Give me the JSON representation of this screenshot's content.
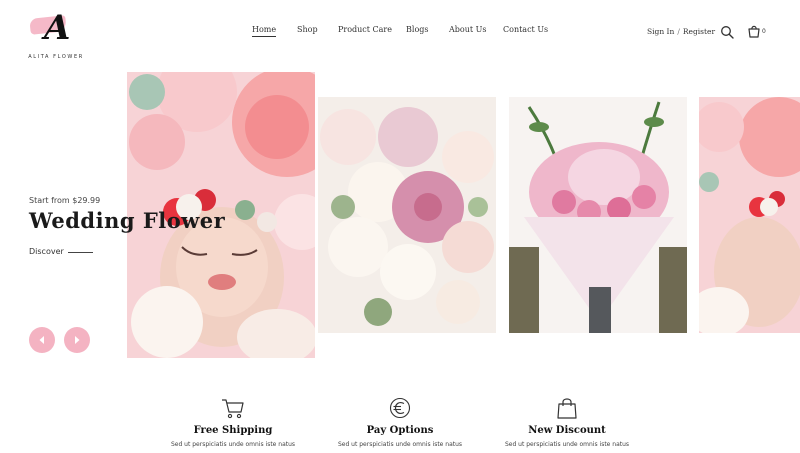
{
  "brand": {
    "letter": "A",
    "name": "ALITA FLOWER"
  },
  "nav": {
    "items": [
      {
        "label": "Home",
        "active": true
      },
      {
        "label": "Shop"
      },
      {
        "label": "Product Care"
      },
      {
        "label": "Blogs"
      },
      {
        "label": "About Us"
      },
      {
        "label": "Contact Us"
      }
    ]
  },
  "account": {
    "signin": "Sign In",
    "separator": "/",
    "register": "Register"
  },
  "header_icons": {
    "search": "search-icon",
    "cart": "cart-icon",
    "cart_count": "0"
  },
  "hero": {
    "subtitle": "Start from $29.99",
    "title": "Wedding Flower",
    "cta": "Discover"
  },
  "slider": {
    "prev": "arrow-left-icon",
    "next": "arrow-right-icon",
    "slides": [
      "baby-with-flower-crown",
      "pastel-bouquet",
      "pink-hydrangea-bouquet",
      "baby-with-flower-crown"
    ]
  },
  "features": [
    {
      "icon": "cart-icon",
      "title": "Free Shipping",
      "desc": "Sed ut perspiciatis unde omnis iste natus"
    },
    {
      "icon": "euro-icon",
      "title": "Pay Options",
      "desc": "Sed ut perspiciatis unde omnis iste natus"
    },
    {
      "icon": "bag-icon",
      "title": "New Discount",
      "desc": "Sed ut perspiciatis unde omnis iste natus"
    }
  ],
  "colors": {
    "accent_pink": "#f4b3c2",
    "text_dark": "#222222",
    "background": "#ffffff"
  }
}
